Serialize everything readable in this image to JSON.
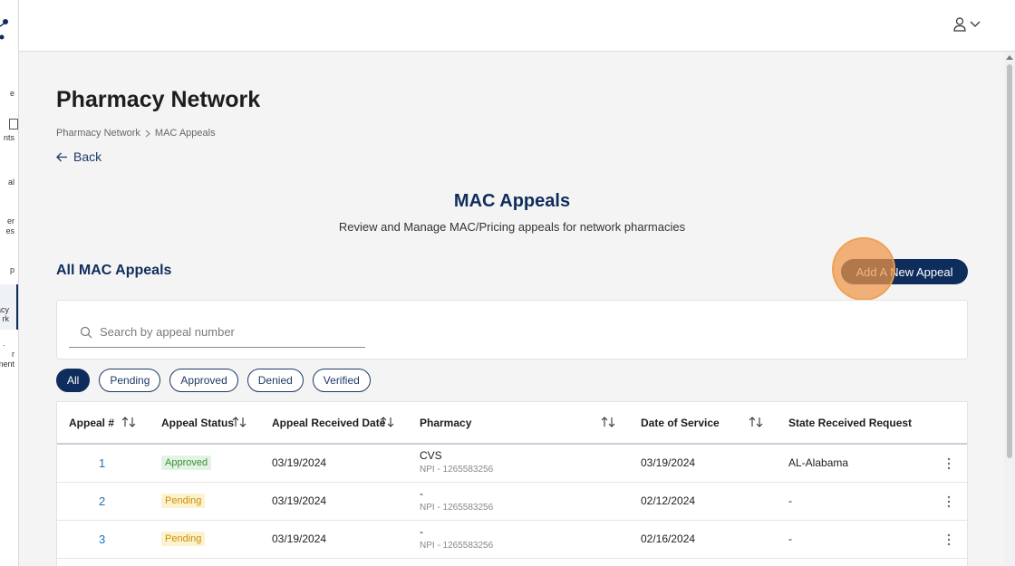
{
  "sidebar": {
    "items": [
      {
        "label": "e"
      },
      {
        "label": "nts"
      },
      {
        "label": "al"
      },
      {
        "label": "er"
      },
      {
        "label": "es"
      },
      {
        "label": "p"
      },
      {
        "label": "acy"
      },
      {
        "label": "rk"
      },
      {
        "label": "r"
      },
      {
        "label": "ment"
      }
    ]
  },
  "header": {
    "user_icon": "user-icon",
    "chevron_icon": "chevron-down-icon"
  },
  "page": {
    "title": "Pharmacy Network",
    "breadcrumb": [
      "Pharmacy Network",
      "MAC Appeals"
    ],
    "back_label": "Back"
  },
  "intro": {
    "title": "MAC Appeals",
    "subtitle": "Review and Manage MAC/Pricing appeals for network pharmacies"
  },
  "section": {
    "title": "All MAC Appeals",
    "add_button": "Add A New Appeal"
  },
  "search": {
    "placeholder": "Search by appeal number",
    "value": ""
  },
  "filters": [
    "All",
    "Pending",
    "Approved",
    "Denied",
    "Verified"
  ],
  "active_filter": "All",
  "table": {
    "columns": [
      "Appeal #",
      "Appeal Status",
      "Appeal Received Date",
      "Pharmacy",
      "Date of Service",
      "State Received Request"
    ],
    "rows": [
      {
        "appeal": "1",
        "status": "Approved",
        "received": "03/19/2024",
        "pharmacy": "CVS",
        "npi": "NPI - 1265583256",
        "dos": "03/19/2024",
        "state": "AL-Alabama"
      },
      {
        "appeal": "2",
        "status": "Pending",
        "received": "03/19/2024",
        "pharmacy": "-",
        "npi": "NPI - 1265583256",
        "dos": "02/12/2024",
        "state": "-"
      },
      {
        "appeal": "3",
        "status": "Pending",
        "received": "03/19/2024",
        "pharmacy": "-",
        "npi": "NPI - 1265583256",
        "dos": "02/16/2024",
        "state": "-"
      }
    ]
  },
  "colors": {
    "primary": "#0f2d5c",
    "link": "#2271b1",
    "approved_bg": "#e2f3e2",
    "approved_text": "#3e8c3e",
    "pending_bg": "#fdf1cf",
    "pending_text": "#c99400",
    "click_marker": "#f0a050"
  }
}
